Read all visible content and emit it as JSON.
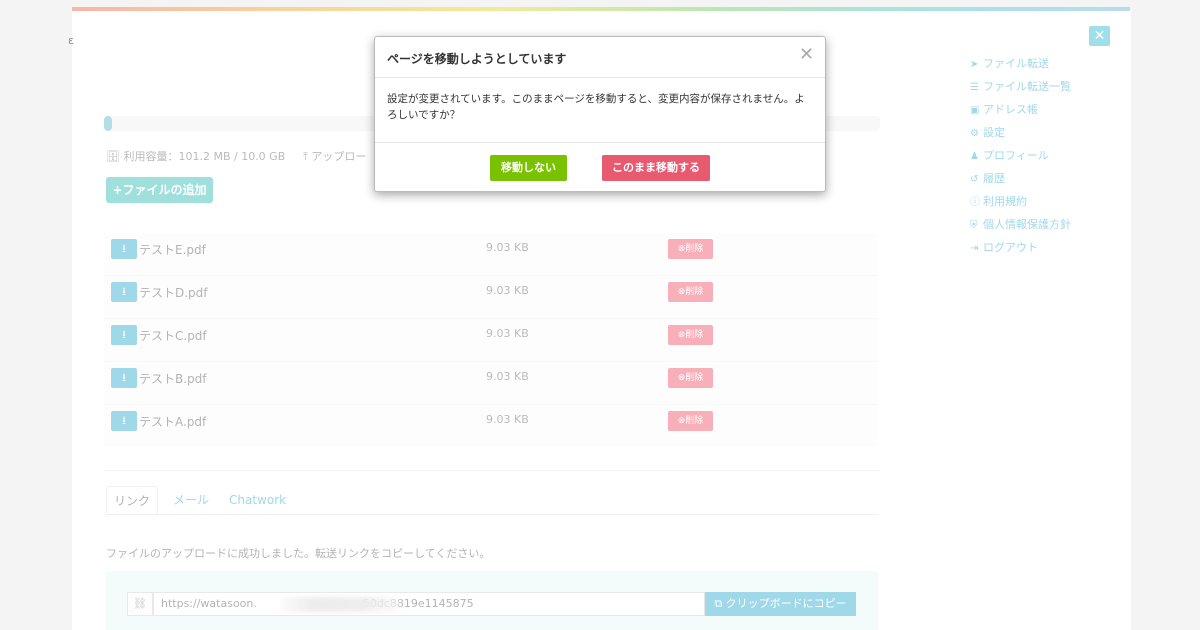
{
  "left_mark": "ε",
  "storage": {
    "progress_percent": 1,
    "usage_icon": "database-icon",
    "usage_text": "利用容量：101.2 MB / 10.0 GB",
    "upload_icon": "upload-icon",
    "upload_text": "アップロー"
  },
  "add_file_button": {
    "icon": "plus-icon",
    "label": "+ファイルの追加"
  },
  "files": [
    {
      "name": "テストE.pdf",
      "size": "9.03 KB",
      "delete_label": "⊗削除"
    },
    {
      "name": "テストD.pdf",
      "size": "9.03 KB",
      "delete_label": "⊗削除"
    },
    {
      "name": "テストC.pdf",
      "size": "9.03 KB",
      "delete_label": "⊗削除"
    },
    {
      "name": "テストB.pdf",
      "size": "9.03 KB",
      "delete_label": "⊗削除"
    },
    {
      "name": "テストA.pdf",
      "size": "9.03 KB",
      "delete_label": "⊗削除"
    }
  ],
  "tabs": [
    {
      "label": "リンク",
      "active": true
    },
    {
      "label": "メール",
      "active": false
    },
    {
      "label": "Chatwork",
      "active": false
    }
  ],
  "success_message": "ファイルのアップロードに成功しました。転送リンクをコピーしてください。",
  "link": {
    "icon": "link-icon",
    "url_start": "https://watasoon.",
    "url_end": "50dc8819e1145875",
    "copy_button": "クリップボードにコピー"
  },
  "sidebar": {
    "close_icon": "close-icon",
    "items": [
      {
        "icon": "paper-plane-icon",
        "label": "ファイル転送"
      },
      {
        "icon": "list-icon",
        "label": "ファイル転送一覧"
      },
      {
        "icon": "address-book-icon",
        "label": "アドレス帳"
      },
      {
        "icon": "gear-icon",
        "label": "設定"
      },
      {
        "icon": "user-icon",
        "label": "プロフィール"
      },
      {
        "icon": "history-icon",
        "label": "履歴"
      },
      {
        "icon": "info-circle-icon",
        "label": "利用規約"
      },
      {
        "icon": "shield-icon",
        "label": "個人情報保護方針"
      },
      {
        "icon": "sign-out-icon",
        "label": "ログアウト"
      }
    ]
  },
  "modal": {
    "title": "ページを移動しようとしています",
    "body": "設定が変更されています。このままページを移動すると、変更内容が保存されません。よろしいですか？",
    "stay_button": "移動しない",
    "leave_button": "このまま移動する",
    "colors": {
      "stay": "#7ac200",
      "leave": "#e85a70"
    }
  }
}
